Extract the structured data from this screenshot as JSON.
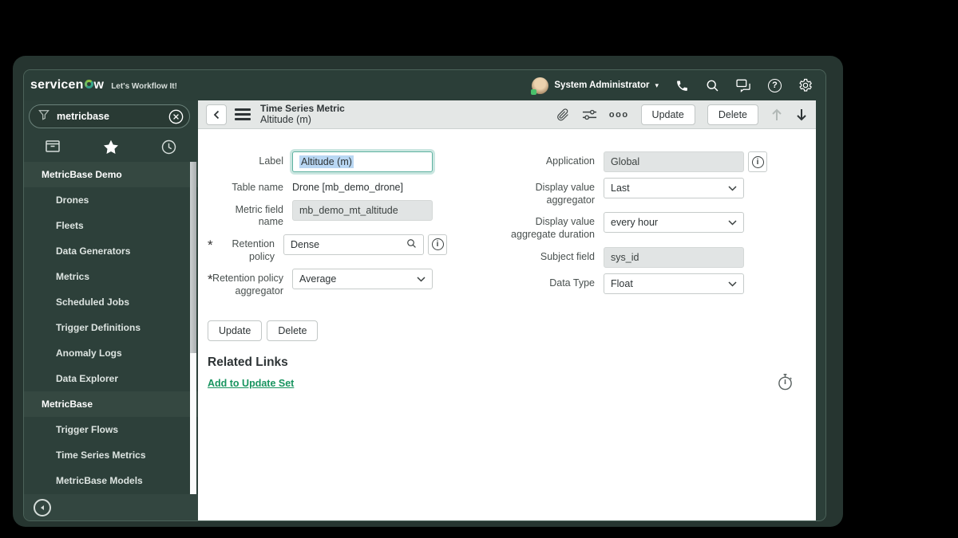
{
  "colors": {
    "header_bg": "#2b3e38",
    "sidebar_bg": "#2d403a",
    "sidebar_section_bg": "#354841",
    "form_header_bg": "#e4e7e6",
    "link_green": "#18945f",
    "focus_border": "#5fb2a1",
    "selection_blue": "#b9d7f3",
    "presence_green": "#49c06b"
  },
  "icons": {
    "caret": "▾",
    "mandatory": "*",
    "help_glyph": "?",
    "info_glyph": "i"
  },
  "header": {
    "logo_left": "servicen",
    "logo_right": "w",
    "tagline": "Let's Workflow It!",
    "user": "System Administrator"
  },
  "sidebar": {
    "filter_value": "metricbase",
    "items": [
      {
        "label": "MetricBase Demo",
        "type": "section"
      },
      {
        "label": "Drones",
        "type": "module"
      },
      {
        "label": "Fleets",
        "type": "module"
      },
      {
        "label": "Data Generators",
        "type": "module"
      },
      {
        "label": "Metrics",
        "type": "module"
      },
      {
        "label": "Scheduled Jobs",
        "type": "module"
      },
      {
        "label": "Trigger Definitions",
        "type": "module"
      },
      {
        "label": "Anomaly Logs",
        "type": "module"
      },
      {
        "label": "Data Explorer",
        "type": "module"
      },
      {
        "label": "MetricBase",
        "type": "section"
      },
      {
        "label": "Trigger Flows",
        "type": "module"
      },
      {
        "label": "Time Series Metrics",
        "type": "module"
      },
      {
        "label": "MetricBase Models",
        "type": "module"
      }
    ]
  },
  "form_header": {
    "title_line1": "Time Series Metric",
    "title_line2": "Altitude (m)",
    "more_label": "ooo",
    "update_label": "Update",
    "delete_label": "Delete"
  },
  "form": {
    "left": [
      {
        "label": "Label",
        "value": "Altitude (m)",
        "type": "text",
        "state": "focused, text selected"
      },
      {
        "label": "Table name",
        "value": "Drone [mb_demo_drone]",
        "type": "static"
      },
      {
        "label": "Metric field name",
        "value": "mb_demo_mt_altitude",
        "type": "readonly"
      },
      {
        "label": "Retention policy",
        "value": "Dense",
        "type": "reference",
        "mandatory": true,
        "info": true
      },
      {
        "label": "Retention policy aggregator",
        "value": "Average",
        "type": "select",
        "mandatory": true
      }
    ],
    "right": [
      {
        "label": "Application",
        "value": "Global",
        "type": "readonly",
        "info": true
      },
      {
        "label": "Display value aggregator",
        "value": "Last",
        "type": "select"
      },
      {
        "label": "Display value aggregate duration",
        "value": "every hour",
        "type": "select"
      },
      {
        "label": "Subject field",
        "value": "sys_id",
        "type": "readonly"
      },
      {
        "label": "Data Type",
        "value": "Float",
        "type": "select"
      }
    ]
  },
  "actions": {
    "update": "Update",
    "delete": "Delete"
  },
  "related_links": {
    "heading": "Related Links",
    "link": "Add to Update Set"
  }
}
